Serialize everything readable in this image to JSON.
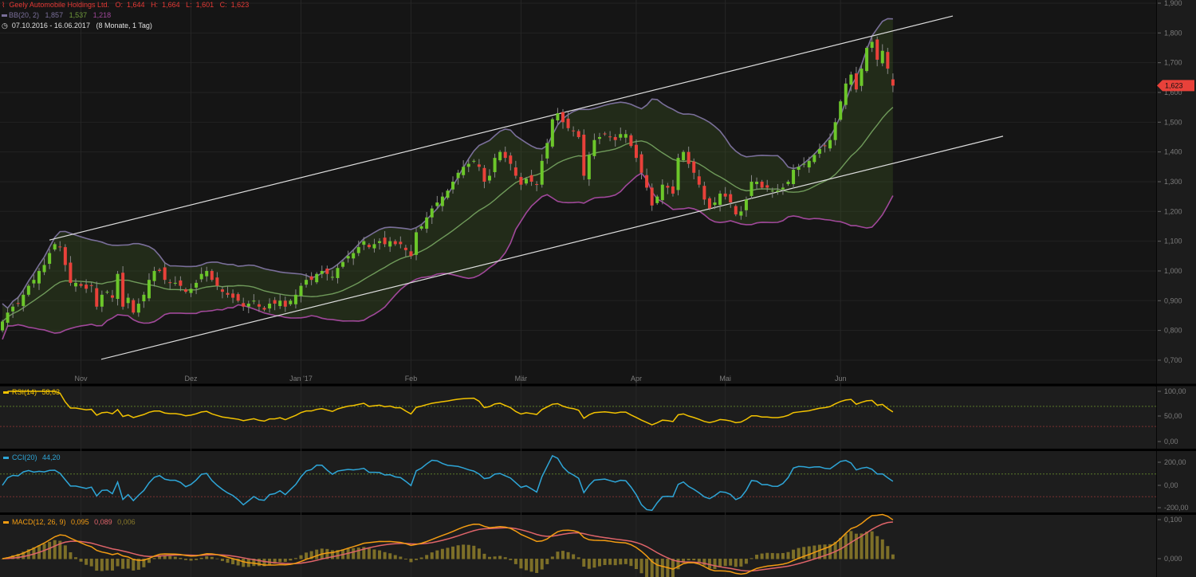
{
  "header": {
    "title": "Geely Automobile Holdings Ltd.",
    "ohlc": {
      "o_label": "O:",
      "o": "1,644",
      "h_label": "H:",
      "h": "1,664",
      "l_label": "L:",
      "l": "1,601",
      "c_label": "C:",
      "c": "1,623"
    },
    "bb": {
      "label": "BB(20, 2)",
      "upper": "1,857",
      "middle": "1,537",
      "lower": "1,218"
    },
    "range": "07.10.2016 - 16.06.2017",
    "duration": "(8 Monate, 1 Tag)",
    "icons": [
      "candlestick-icon",
      "clock-icon"
    ]
  },
  "indicators": {
    "rsi": {
      "label": "RSI(14)",
      "value": "58,63",
      "color": "#f2c200"
    },
    "cci": {
      "label": "CCI(20)",
      "value": "44,20",
      "color": "#2ea6d8"
    },
    "macd": {
      "label": "MACD(12, 26, 9)",
      "macd": "0,095",
      "signal": "0,089",
      "hist": "0,006",
      "color": "#f39c12",
      "signal_color": "#e0646a",
      "hist_color": "#8a7a2a"
    }
  },
  "chart_data": {
    "type": "candlestick",
    "title": "Geely Automobile Holdings Ltd.",
    "period": "07.10.2016 - 16.06.2017",
    "ylim": [
      0.65,
      1.92
    ],
    "y_ticks": [
      "1,900",
      "1,800",
      "1,700",
      "1,600",
      "1,500",
      "1,400",
      "1,300",
      "1,200",
      "1,100",
      "1,000",
      "0,900",
      "0,800",
      "0,700"
    ],
    "x_ticks": [
      "Nov",
      "Dez",
      "Jan '17",
      "Feb",
      "Mär",
      "Apr",
      "Mai",
      "Jun"
    ],
    "last_price_label": "1,623",
    "last_candle": {
      "open": 1.644,
      "high": 1.664,
      "low": 1.601,
      "close": 1.623
    },
    "closes": [
      0.83,
      0.86,
      0.88,
      0.89,
      0.92,
      0.95,
      0.97,
      1.0,
      1.02,
      1.06,
      1.09,
      1.08,
      1.02,
      0.96,
      0.96,
      0.95,
      0.94,
      0.95,
      0.88,
      0.92,
      0.93,
      0.91,
      0.99,
      0.88,
      0.91,
      0.86,
      0.89,
      0.92,
      0.97,
      1.0,
      1.0,
      0.97,
      0.96,
      0.96,
      0.95,
      0.93,
      0.94,
      0.96,
      0.99,
      1.0,
      0.97,
      0.95,
      0.93,
      0.92,
      0.91,
      0.9,
      0.88,
      0.89,
      0.9,
      0.88,
      0.87,
      0.89,
      0.89,
      0.9,
      0.88,
      0.9,
      0.92,
      0.95,
      0.97,
      0.97,
      0.99,
      1.0,
      0.99,
      0.98,
      1.01,
      1.03,
      1.05,
      1.06,
      1.08,
      1.1,
      1.08,
      1.09,
      1.1,
      1.09,
      1.1,
      1.09,
      1.09,
      1.07,
      1.05,
      1.13,
      1.15,
      1.18,
      1.21,
      1.23,
      1.25,
      1.27,
      1.3,
      1.33,
      1.35,
      1.36,
      1.37,
      1.35,
      1.3,
      1.32,
      1.38,
      1.4,
      1.38,
      1.36,
      1.32,
      1.29,
      1.31,
      1.3,
      1.29,
      1.37,
      1.43,
      1.51,
      1.53,
      1.5,
      1.48,
      1.47,
      1.45,
      1.32,
      1.39,
      1.44,
      1.45,
      1.46,
      1.45,
      1.44,
      1.46,
      1.46,
      1.42,
      1.38,
      1.33,
      1.28,
      1.22,
      1.25,
      1.29,
      1.28,
      1.26,
      1.38,
      1.4,
      1.36,
      1.33,
      1.29,
      1.24,
      1.21,
      1.23,
      1.26,
      1.25,
      1.23,
      1.19,
      1.2,
      1.24,
      1.3,
      1.3,
      1.28,
      1.28,
      1.27,
      1.27,
      1.28,
      1.3,
      1.34,
      1.35,
      1.36,
      1.37,
      1.39,
      1.41,
      1.42,
      1.44,
      1.5,
      1.57,
      1.63,
      1.66,
      1.61,
      1.68,
      1.75,
      1.77,
      1.71,
      1.74,
      1.68,
      1.623
    ],
    "bollinger": {
      "period": 20,
      "stddev": 2,
      "upper_color": "#7a6f9a",
      "middle_color": "#6f9a5a",
      "lower_color": "#a0489a"
    },
    "trend_channel": {
      "upper": [
        1.104,
        1.857
      ],
      "lower": [
        0.703,
        1.453
      ]
    },
    "rsi_ticks": [
      "100,00",
      "50,00",
      "0,00"
    ],
    "cci_ticks": [
      "200,00",
      "0,00",
      "-200,00"
    ],
    "macd_ticks": [
      "0,100",
      "0,000"
    ],
    "up_color": "#6cc72a",
    "down_color": "#e8413a"
  }
}
